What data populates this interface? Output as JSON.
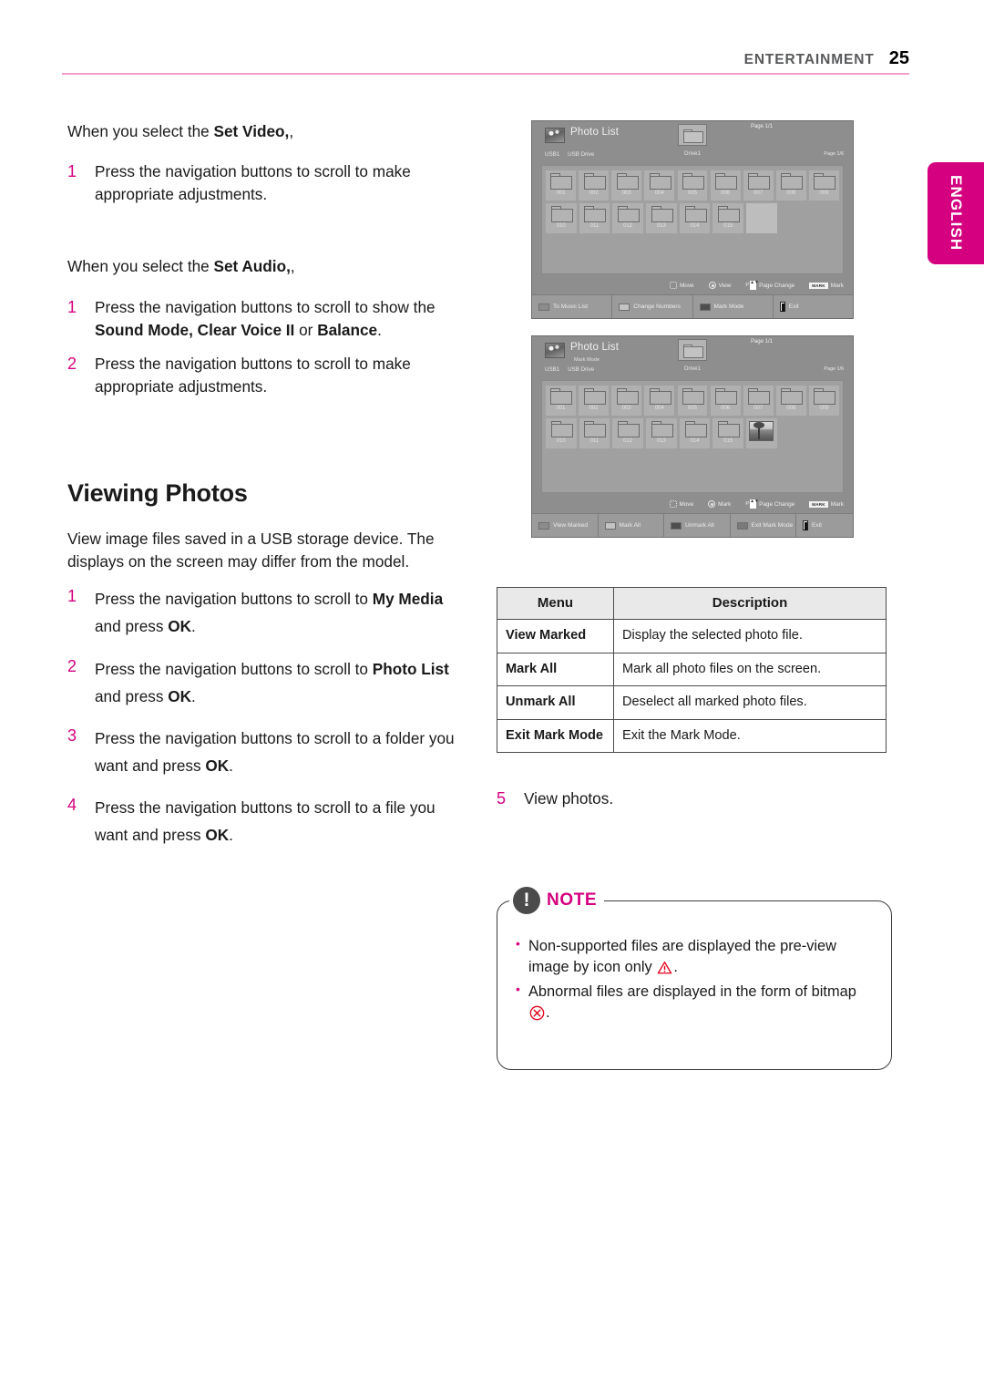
{
  "header": {
    "chapter": "ENTERTAINMENT",
    "page_number": "25"
  },
  "lang_tab": {
    "label": "ENGLISH",
    "color": "#d4007f"
  },
  "left_column": {
    "set_video_intro_prefix": "When you select the ",
    "set_video_intro_bold": "Set Video,",
    "set_video_intro_suffix": ",",
    "set_video_steps": [
      {
        "num": "1",
        "text": "Press the navigation buttons to scroll to make appropriate adjustments."
      }
    ],
    "set_audio_intro_prefix": "When you select the ",
    "set_audio_intro_bold": "Set Audio,",
    "set_audio_intro_suffix": ",",
    "set_audio_step1_a": "Press the navigation buttons to scroll to show the ",
    "set_audio_step1_b": "Sound Mode, Clear Voice II",
    "set_audio_step1_c": " or ",
    "set_audio_step1_d": "Balance",
    "set_audio_step1_e": ".",
    "set_audio_step1_num": "1",
    "set_audio_step2_num": "2",
    "set_audio_step2_text": "Press the navigation buttons to scroll to make appropriate adjustments.",
    "section_title": "Viewing Photos",
    "section_intro": "View image files saved in a USB storage device. The displays on the screen may differ from the model.",
    "photo_steps": [
      {
        "num": "1",
        "a": "Press the navigation buttons to scroll to ",
        "b": "My Media",
        "c": " and press ",
        "d": "OK",
        "e": "."
      },
      {
        "num": "2",
        "a": "Press the navigation buttons to scroll to ",
        "b": "Photo List",
        "c": " and press ",
        "d": "OK",
        "e": "."
      },
      {
        "num": "3",
        "a": "Press the navigation buttons to scroll to a folder you want and press ",
        "b": "",
        "c": "",
        "d": "OK",
        "e": "."
      },
      {
        "num": "4",
        "a": "Press the navigation buttons to scroll to a file you want and press ",
        "b": "",
        "c": "",
        "d": "OK",
        "e": "."
      }
    ]
  },
  "screenshot_one": {
    "title": "Photo List",
    "submode": "",
    "source_port": "USB1",
    "source_name": "USB Drive",
    "drive_label": "Drive1",
    "page_top": "Page 1/1",
    "page_right": "Page 1/6",
    "folders_row1": [
      "001",
      "002",
      "003",
      "004",
      "005",
      "006",
      "007",
      "008",
      "009"
    ],
    "folders_row2": [
      "010",
      "011",
      "012",
      "013",
      "014",
      "015"
    ],
    "hints": [
      {
        "icon": "dpad-icon",
        "label": "Move"
      },
      {
        "icon": "ok-icon",
        "label": "View"
      },
      {
        "icon": "page-updown-icon",
        "label": "Page Change",
        "prefix": "P"
      },
      {
        "icon": "mark-key-icon",
        "label": "Mark",
        "key": "MARK"
      }
    ],
    "footer_buttons": [
      {
        "color": "red",
        "label": "To Music List"
      },
      {
        "color": "green",
        "label": "Change Numbers"
      },
      {
        "color": "yellow",
        "label": "Mark Mode"
      },
      {
        "color": "exit",
        "label": "Exit"
      }
    ]
  },
  "screenshot_two": {
    "title": "Photo List",
    "submode": "Mark Mode",
    "source_port": "USB1",
    "source_name": "USB Drive",
    "drive_label": "Drive1",
    "page_top": "Page 1/1",
    "page_right": "Page 1/6",
    "folders_row1": [
      "001",
      "002",
      "003",
      "004",
      "005",
      "006",
      "007",
      "008",
      "009"
    ],
    "folders_row2": [
      "010",
      "011",
      "012",
      "013",
      "014",
      "015"
    ],
    "photo_thumb": true,
    "hints": [
      {
        "icon": "dpad-icon",
        "label": "Move"
      },
      {
        "icon": "ok-icon",
        "label": "Mark"
      },
      {
        "icon": "page-updown-icon",
        "label": "Page Change",
        "prefix": "P"
      },
      {
        "icon": "mark-key-icon",
        "label": "Mark",
        "key": "MARK"
      }
    ],
    "footer_buttons": [
      {
        "color": "red",
        "label": "View Marked"
      },
      {
        "color": "green",
        "label": "Mark All"
      },
      {
        "color": "yellow",
        "label": "Unmark All"
      },
      {
        "color": "blue",
        "label": "Exit Mark Mode"
      },
      {
        "color": "exit",
        "label": "Exit"
      }
    ]
  },
  "menu_table": {
    "headers": [
      "Menu",
      "Description"
    ],
    "rows": [
      {
        "menu": "View Marked",
        "description": "Display the selected photo file."
      },
      {
        "menu": "Mark All",
        "description": "Mark all photo files on the screen."
      },
      {
        "menu": "Unmark All",
        "description": "Deselect all marked photo files."
      },
      {
        "menu": "Exit Mark Mode",
        "description": "Exit the Mark Mode."
      }
    ]
  },
  "right_column": {
    "step5_num": "5",
    "step5_text": "View photos."
  },
  "note": {
    "label": "NOTE",
    "bang": "!",
    "items": [
      {
        "a": "Non-supported files are displayed the pre-view image by icon only ",
        "icon": "warning-triangle-icon",
        "b": "."
      },
      {
        "a": "Abnormal files are displayed in the form of bitmap ",
        "icon": "x-circle-icon",
        "b": "."
      }
    ]
  }
}
